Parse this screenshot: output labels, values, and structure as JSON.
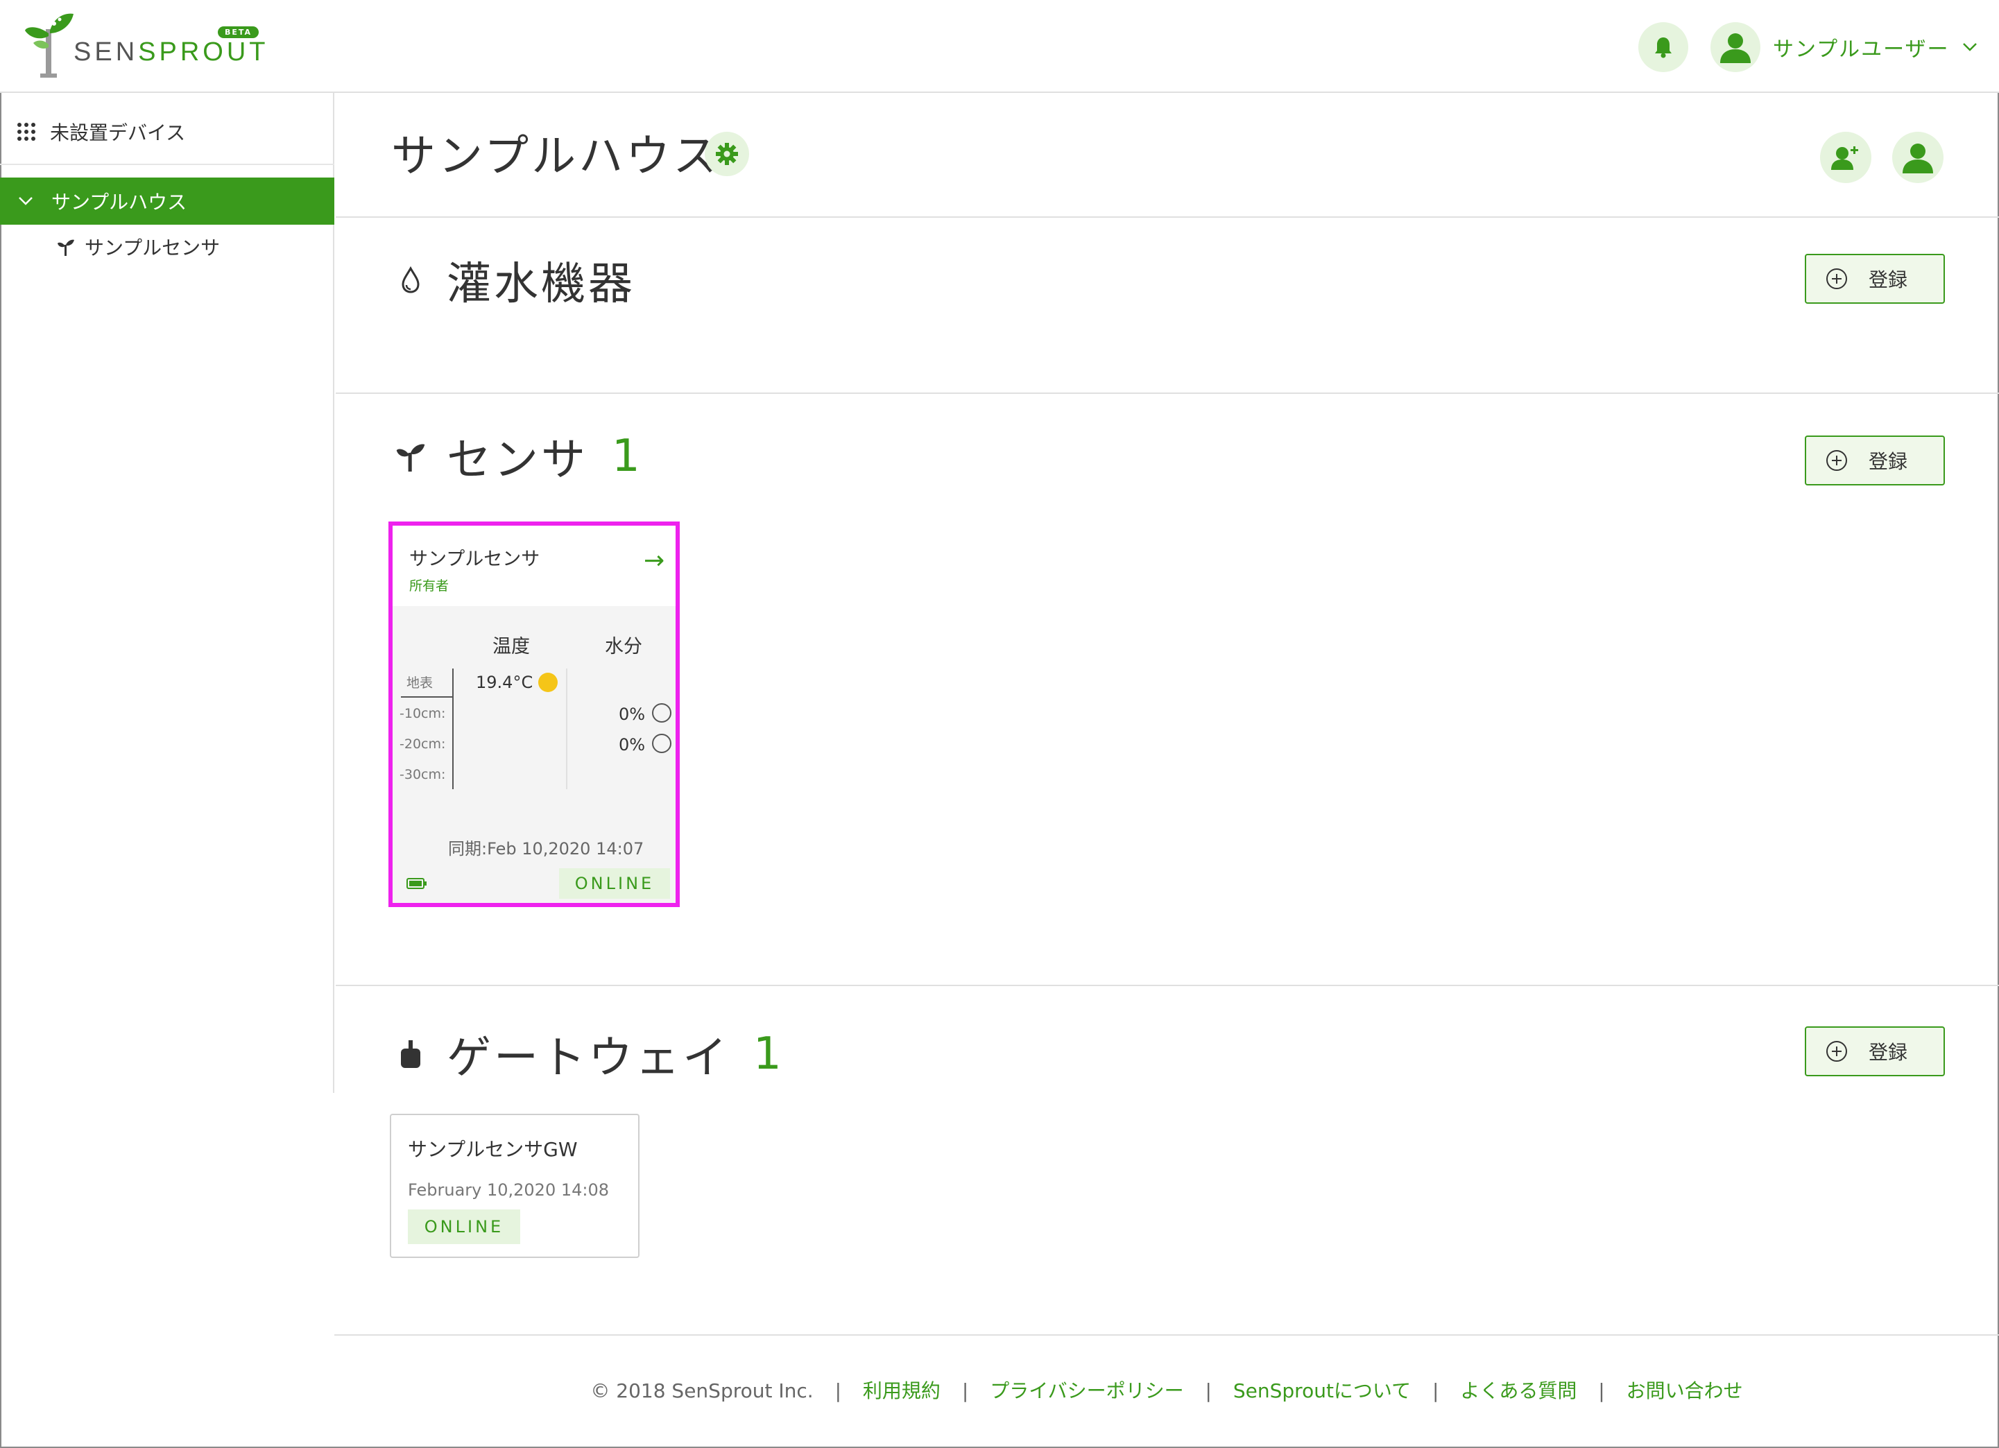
{
  "header": {
    "logo_text_prefix": "SEN",
    "logo_text_suffix": "SPROUT",
    "beta_badge": "BETA",
    "user_name": "サンプルユーザー"
  },
  "sidebar": {
    "unset_devices": "未設置デバイス",
    "house": "サンプルハウス",
    "sensor": "サンプルセンサ"
  },
  "house": {
    "title": "サンプルハウス"
  },
  "sections": {
    "irrigation": {
      "title": "灌水機器",
      "register_label": "登録"
    },
    "sensor": {
      "title": "センサ",
      "count": "1",
      "register_label": "登録"
    },
    "gateway": {
      "title": "ゲートウェイ",
      "count": "1",
      "register_label": "登録"
    }
  },
  "sensor_card": {
    "name": "サンプルセンサ",
    "role": "所有者",
    "arrow": "→",
    "col_temperature": "温度",
    "col_moisture": "水分",
    "row_surface": "地表",
    "row_10": "-10cm:",
    "row_20": "-20cm:",
    "row_30": "-30cm:",
    "surface_temp": "19.4°C",
    "moisture_10": "0%",
    "moisture_20": "0%",
    "sync": "同期:Feb 10,2020 14:07",
    "status": "ONLINE",
    "temp_indicator_color": "#f5c518"
  },
  "gateway_card": {
    "name": "サンプルセンサGW",
    "date": "February 10,2020 14:08",
    "status": "ONLINE"
  },
  "footer": {
    "copyright": "© 2018 SenSprout Inc.",
    "links": [
      "利用規約",
      "プライバシーポリシー",
      "SenSproutについて",
      "よくある質問",
      "お問い合わせ"
    ]
  },
  "colors": {
    "brand": "#3a9a1c",
    "brand_light": "#e6f4de",
    "highlight": "#ee22ee"
  }
}
